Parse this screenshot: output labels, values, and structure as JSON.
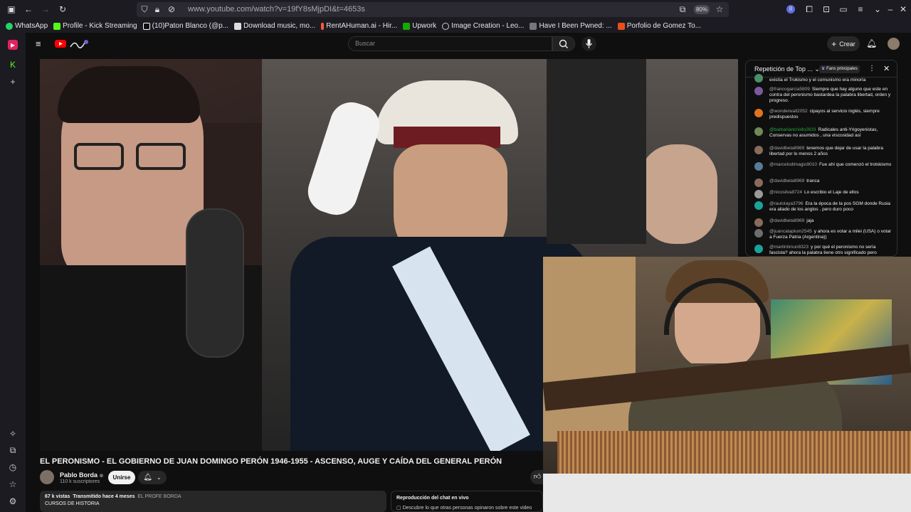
{
  "browser": {
    "url": "www.youtube.com/watch?v=19fY8sMjpDI&t=4653s",
    "zoom": "80%"
  },
  "bookmarks": [
    {
      "label": "WhatsApp",
      "color": "#25d366"
    },
    {
      "label": "Profile - Kick Streaming",
      "color": "#53fc18"
    },
    {
      "label": "(10)Paton Blanco (@p...",
      "color": "#ffffff"
    },
    {
      "label": "Download music, mo...",
      "color": "#dddddd"
    },
    {
      "label": "RentAHuman.ai - Hir...",
      "color": "#ff5a36"
    },
    {
      "label": "Upwork",
      "color": "#14a800"
    },
    {
      "label": "Image Creation - Leo...",
      "color": "#cccccc"
    },
    {
      "label": "Have I Been Pwned: ...",
      "color": "#cccccc"
    },
    {
      "label": "Porfolio de Gomez To...",
      "color": "#e94e1b"
    }
  ],
  "youtube": {
    "search_placeholder": "Buscar",
    "create_label": "Crear",
    "video_title": "EL PERONISMO - EL GOBIERNO DE JUAN DOMINGO PERÓN 1946-1955 - ASCENSO, AUGE Y CAÍDA DEL GENERAL PERÓN",
    "channel_name": "Pablo Borda",
    "subscribers": "110 k suscriptores",
    "join_label": "Unirse",
    "views": "67 k vistas",
    "streamed": "Transmitido hace 4 meses",
    "channel_tag": "EL PROFE BORDA",
    "desc_line2": "CURSOS DE HISTORIA",
    "replay_title": "Reproducción del chat en vivo",
    "replay_sub": "Descubre lo que otras personas opinaron sobre este video"
  },
  "chat": {
    "title": "Repetición de Top ...",
    "badge": "Fans principales",
    "messages": [
      {
        "author": "",
        "text": "existía el Trokismo y el comunismo era minoría",
        "color": "#4a8f6a",
        "member": false
      },
      {
        "author": "@francogarcia5809",
        "text": "Siempre que hay alguno que este en contra del peronismo bastardea la palabra libertad, orden y progreso.",
        "color": "#7a5a9c",
        "member": false
      },
      {
        "author": "@wonderwall2052",
        "text": "cipayos al servicio inglés, siempre predispuestos",
        "color": "#e2721d",
        "member": false
      },
      {
        "author": "@barbariancriollo2633",
        "text": "Radicales anti-Yrigoyenistas, Conservas no asumidos , una viscosidad así",
        "color": "#6f8a5a",
        "member": true
      },
      {
        "author": "@davidbeta8969",
        "text": "tenemos que dejar de usar la palabra libertad por lo menos 2 años",
        "color": "#8a6a5a",
        "member": false
      },
      {
        "author": "@marcelodimagio9010",
        "text": "Fue ahí que comenzó el trotskismo",
        "color": "#5a7a9a",
        "member": false
      },
      {
        "author": "@davidbeta8969",
        "text": "tranca",
        "color": "#8a6a5a",
        "member": false
      },
      {
        "author": "@nicosilva8724",
        "text": "Lo escribio el Laje de ellos",
        "color": "#9a9a9a",
        "member": false
      },
      {
        "author": "@raulolaya3796",
        "text": "Era la época de la pos SGM donde Rusia era aliado de los anglos . pero duro poco",
        "color": "#1aa39b",
        "member": false
      },
      {
        "author": "@davidbeta8969",
        "text": "jaja",
        "color": "#8a6a5a",
        "member": false
      },
      {
        "author": "@juancataplum2545",
        "text": "y ahora es votar a milei (USA) o votar a Fuerza Patria (Argentina))",
        "color": "#6d6d6d",
        "member": false
      },
      {
        "author": "@martintimun8323",
        "text": "y por qué el peronismo no sería fascista? ahora la palabra tiene otro significado pero",
        "color": "#1aa39b",
        "member": false
      }
    ]
  }
}
